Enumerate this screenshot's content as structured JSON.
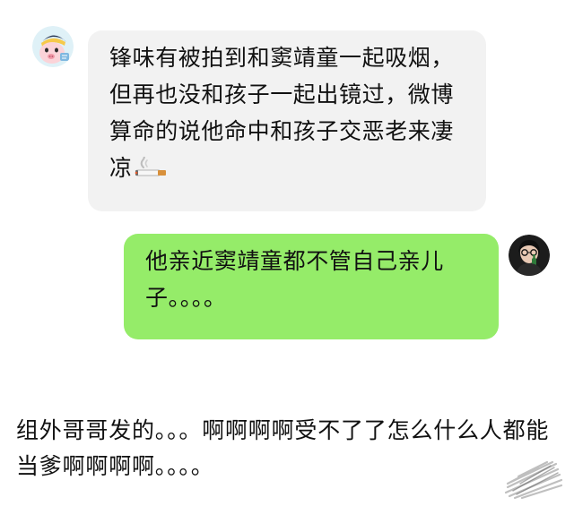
{
  "chat": {
    "messages": [
      {
        "side": "left",
        "text": "锋味有被拍到和窦靖童一起吸烟，但再也没和孩子一起出镜过，微博算命的说他命中和孩子交恶老来凄凉",
        "emoji": "cigarette-icon",
        "bubble_color": "#f2f2f2"
      },
      {
        "side": "right",
        "text": "他亲近窦靖童都不管自己亲儿子。。。。",
        "bubble_color": "#95ec69"
      }
    ]
  },
  "caption": {
    "text": "组外哥哥发的。。。啊啊啊啊受不了了怎么什么人都能当爹啊啊啊啊。。。。"
  }
}
